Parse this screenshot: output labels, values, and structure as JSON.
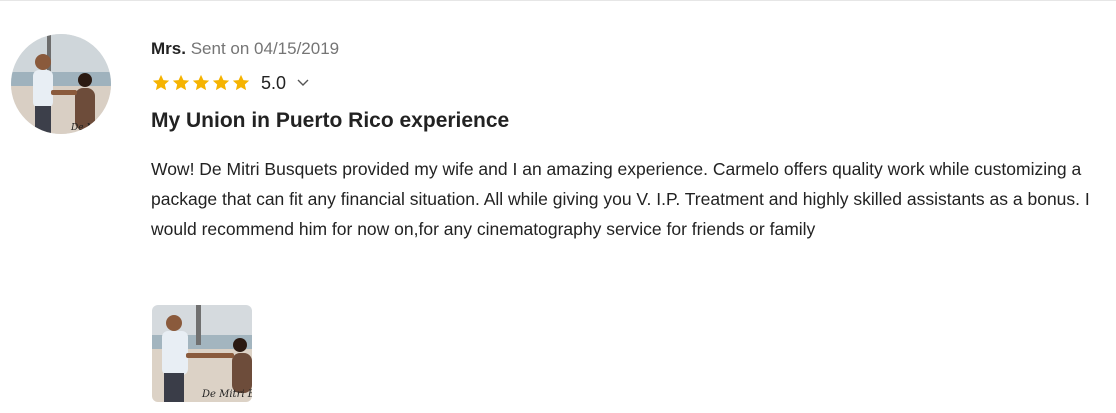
{
  "review": {
    "reviewer_name": "Mrs.",
    "sent_label": "Sent on 04/15/2019",
    "rating_value": "5.0",
    "star_count": 5,
    "star_color": "#F5B301",
    "title": "My Union in Puerto Rico experience",
    "body": "Wow! De Mitri Busquets provided my wife and I an amazing experience. Carmelo offers quality work while customizing a package that can fit any financial situation. All while giving you V. I.P. Treatment and highly skilled assistants as a bonus. I would recommend him for now on,for any cinematography service for friends or family",
    "photo_logo_text": "De Mitri Bu"
  }
}
